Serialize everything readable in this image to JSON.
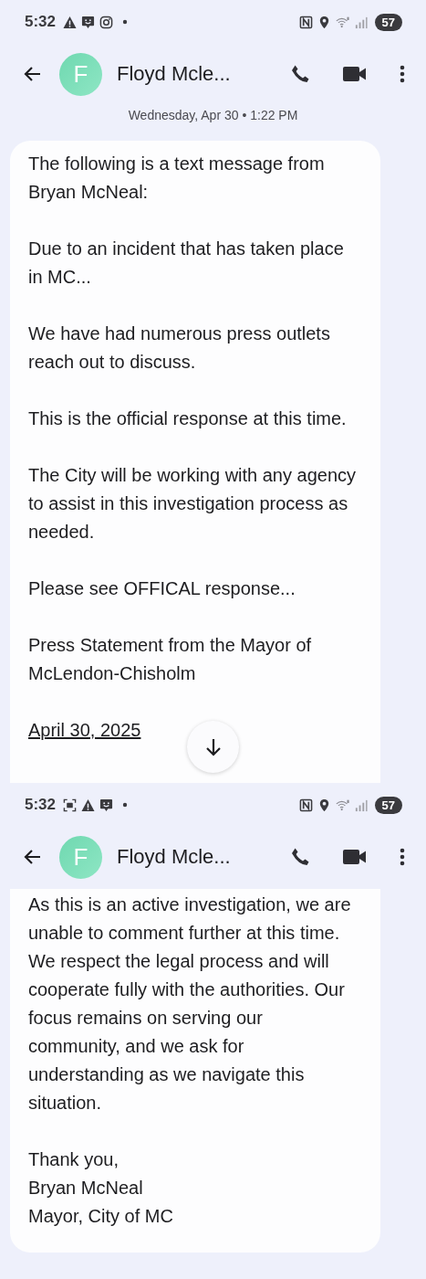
{
  "screens": [
    {
      "status_bar": {
        "time": "5:32",
        "notification_icons": [
          {
            "kind": "warning"
          },
          {
            "kind": "chat"
          },
          {
            "kind": "camera"
          }
        ],
        "battery": "57"
      },
      "header": {
        "avatar_letter": "F",
        "contact_name": "Floyd Mcle..."
      },
      "timestamp": "Wednesday, Apr 30 • 1:22 PM",
      "scroll_button": true,
      "message": [
        {
          "kind": "text",
          "text": "The following is a text message from Bryan McNeal:"
        },
        {
          "kind": "text",
          "text": "Due to an incident that has taken place in MC..."
        },
        {
          "kind": "text",
          "text": "We have had numerous press outlets reach out to discuss."
        },
        {
          "kind": "text",
          "text": "This is the official response at this time."
        },
        {
          "kind": "text",
          "text": "The City will be working with any agency to assist in this investigation process as needed."
        },
        {
          "kind": "text",
          "text": "Please see OFFICAL response..."
        },
        {
          "kind": "text",
          "text": "Press Statement from the Mayor of McLendon-Chisholm"
        },
        {
          "kind": "link",
          "text": "April 30, 2025"
        }
      ]
    },
    {
      "status_bar": {
        "time": "5:32",
        "notification_icons": [
          {
            "kind": "screenshot"
          },
          {
            "kind": "warning"
          },
          {
            "kind": "chat"
          }
        ],
        "battery": "57"
      },
      "header": {
        "avatar_letter": "F",
        "contact_name": "Floyd Mcle..."
      },
      "message": [
        {
          "kind": "text",
          "text": "As this is an active investigation, we are unable to comment further at this time. We respect the legal process and will cooperate fully with the authorities. Our focus remains on serving our community, and we ask for understanding as we navigate this situation."
        },
        {
          "kind": "line",
          "text": "Thank you,"
        },
        {
          "kind": "line",
          "text": "Bryan McNeal"
        },
        {
          "kind": "line",
          "text": "Mayor, City of MC"
        }
      ]
    }
  ]
}
